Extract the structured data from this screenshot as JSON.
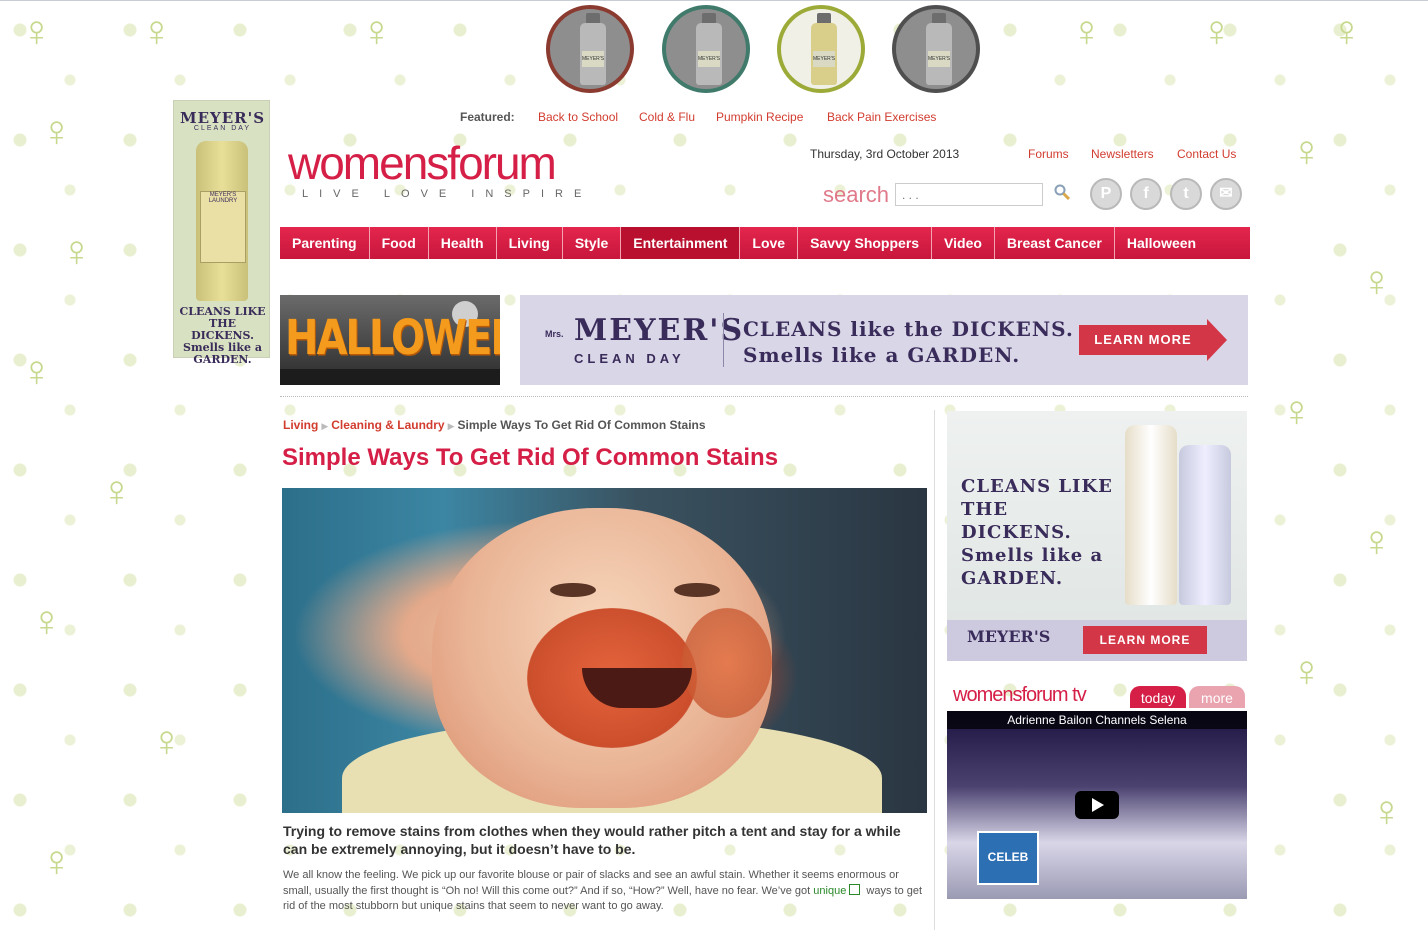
{
  "featured": {
    "label": "Featured:",
    "links": [
      "Back to School",
      "Cold & Flu",
      "Pumpkin Recipe",
      "Back Pain Exercises"
    ]
  },
  "product_circles": [
    {
      "label": "MEYER'S",
      "border_color": "#8a3a2f"
    },
    {
      "label": "MEYER'S",
      "border_color": "#3f7a6a"
    },
    {
      "label": "MEYER'S",
      "border_color": "#9caa38"
    },
    {
      "label": "MEYER'S",
      "border_color": "#4f4f4f"
    }
  ],
  "left_ad": {
    "brand": "MEYER'S",
    "sub": "CLEAN DAY",
    "bottle_label": "MEYER'S LAUNDRY",
    "tagline": "CLEANS LIKE THE DICKENS. Smells like a GARDEN."
  },
  "logo": {
    "main_a": "womens",
    "main_b": "forum",
    "tagline": "LIVE LOVE INSPIRE"
  },
  "header": {
    "date": "Thursday, 3rd October 2013",
    "links": [
      "Forums",
      "Newsletters",
      "Contact Us"
    ],
    "search_label": "search",
    "search_placeholder": ". . ."
  },
  "social": [
    "P",
    "f",
    "t",
    "✉"
  ],
  "nav": {
    "items": [
      "Parenting",
      "Food",
      "Health",
      "Living",
      "Style",
      "Entertainment",
      "Love",
      "Savvy Shoppers",
      "Video",
      "Breast Cancer",
      "Halloween"
    ],
    "active": "Entertainment"
  },
  "halloween_banner": {
    "text": "HALLOWEEN"
  },
  "top_banner": {
    "mrs": "Mrs.",
    "brand": "MEYER'S",
    "brand_sub": "CLEAN DAY",
    "line1": "CLEANS like the DICKENS.",
    "line2": "Smells like a GARDEN.",
    "cta": "LEARN MORE"
  },
  "breadcrumb": {
    "items": [
      "Living",
      "Cleaning & Laundry"
    ],
    "current": "Simple Ways To Get Rid Of Common Stains"
  },
  "article": {
    "title": "Simple Ways To Get Rid Of Common Stains",
    "lead": "Trying to remove stains from clothes when they would rather pitch a tent and stay for a while can be extremely annoying, but it doesn’t have to be.",
    "body_part1": "We all know the feeling. We pick up our favorite blouse or pair of slacks and see an awful stain. Whether it seems enormous or small, usually the first thought is “Oh no! Will this come out?” And if so, “How?” Well, have no fear. We’ve got",
    "body_link": "unique",
    "body_part2": "ways to get rid of the most stubborn but unique stains that seem to never want to go away."
  },
  "side_ad": {
    "text": "CLEANS LIKE THE DICKENS. Smells like a GARDEN.",
    "brand": "MEYER'S",
    "cta": "LEARN MORE"
  },
  "tv": {
    "heading": "womensforum tv",
    "tabs": [
      "today",
      "more"
    ],
    "video_caption": "Adrienne Bailon Channels Selena",
    "channel_logo": "CELEB TV"
  },
  "colors": {
    "brand": "#d51f47",
    "link": "#d23c2f",
    "nav": "#d51f47"
  }
}
